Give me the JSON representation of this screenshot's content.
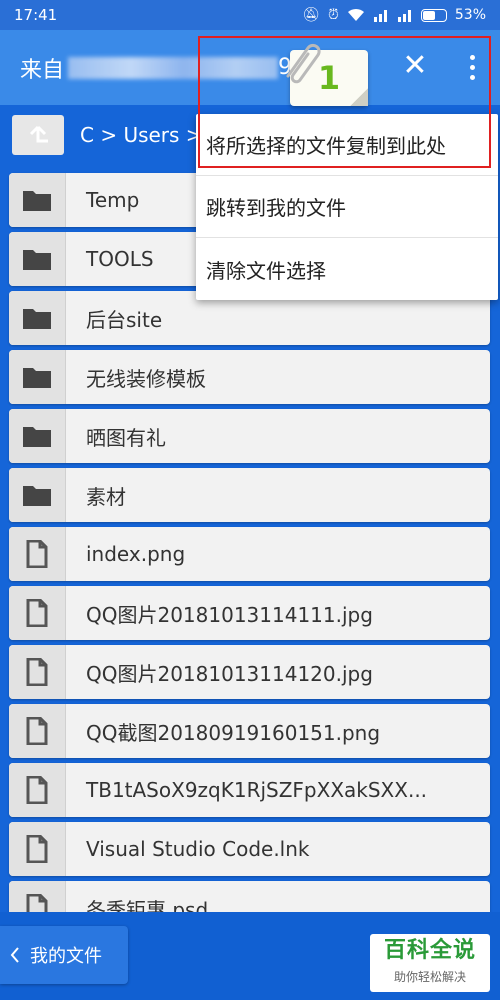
{
  "status": {
    "time": "17:41",
    "battery": "53%"
  },
  "app_bar": {
    "title": "来自",
    "title_suffix": "9"
  },
  "selection": {
    "count": "1"
  },
  "path": {
    "text": "C > Users >"
  },
  "files": [
    {
      "name": "Temp",
      "type": "folder"
    },
    {
      "name": "TOOLS",
      "type": "folder"
    },
    {
      "name": "后台site",
      "type": "folder"
    },
    {
      "name": "无线装修模板",
      "type": "folder"
    },
    {
      "name": "晒图有礼",
      "type": "folder"
    },
    {
      "name": "素材",
      "type": "folder"
    },
    {
      "name": "index.png",
      "type": "file"
    },
    {
      "name": "QQ图片20181013114111.jpg",
      "type": "file"
    },
    {
      "name": "QQ图片20181013114120.jpg",
      "type": "file"
    },
    {
      "name": "QQ截图20180919160151.png",
      "type": "file"
    },
    {
      "name": "TB1tASoX9zqK1RjSZFpXXakSXX...",
      "type": "file"
    },
    {
      "name": "Visual Studio Code.lnk",
      "type": "file"
    },
    {
      "name": "冬季钜惠.psd",
      "type": "file"
    }
  ],
  "popup_menu": {
    "items": [
      {
        "label": "将所选择的文件复制到此处"
      },
      {
        "label": "跳转到我的文件"
      },
      {
        "label": "清除文件选择"
      }
    ]
  },
  "bottom_bar": {
    "back_label": "我的文件"
  },
  "watermark": {
    "title": "百科全说",
    "subtitle": "助你轻松解决"
  },
  "colors": {
    "primary": "#1565d8",
    "app_bar": "#3a8ae8",
    "highlight": "#e02020",
    "badge_number": "#68b81e"
  },
  "icons": {
    "folder": "folder-icon",
    "file": "file-icon",
    "up": "up-arrow-icon",
    "close": "close-icon",
    "more": "more-vert-icon",
    "clip": "paperclip-icon",
    "back": "chevron-left-icon"
  }
}
